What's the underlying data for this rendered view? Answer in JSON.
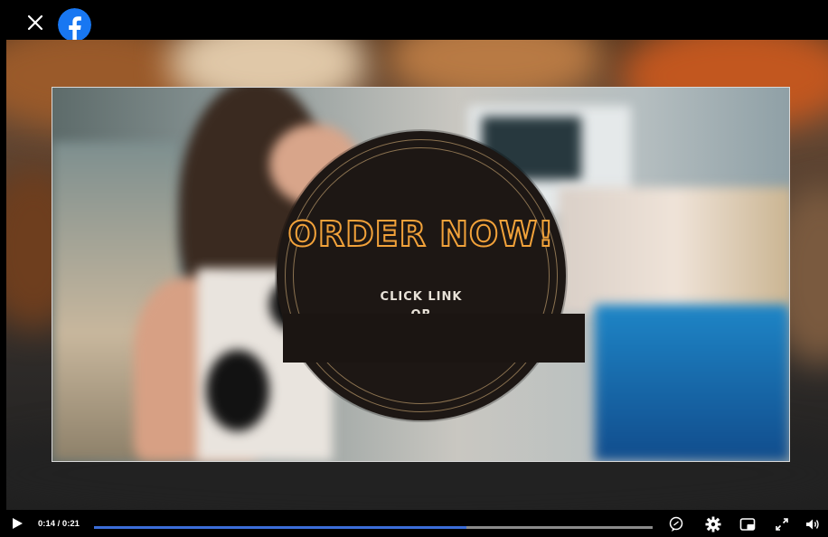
{
  "viewer": {
    "close_icon": "close-icon",
    "logo_icon": "facebook-logo-icon",
    "brand_color": "#1877F2"
  },
  "video": {
    "headline": "ORDER NOW!",
    "line1": "CLICK LINK",
    "line2": "OR",
    "accent_color": "#F2A23A"
  },
  "controls": {
    "play_icon": "play-icon",
    "current_time": "0:14",
    "duration": "0:21",
    "time_display": "0:14 / 0:21",
    "progress_fraction": 0.667,
    "progress_color": "#3B6DD8",
    "icons": [
      "captions-icon",
      "settings-icon",
      "picture-in-picture-icon",
      "fullscreen-icon",
      "volume-icon"
    ]
  }
}
